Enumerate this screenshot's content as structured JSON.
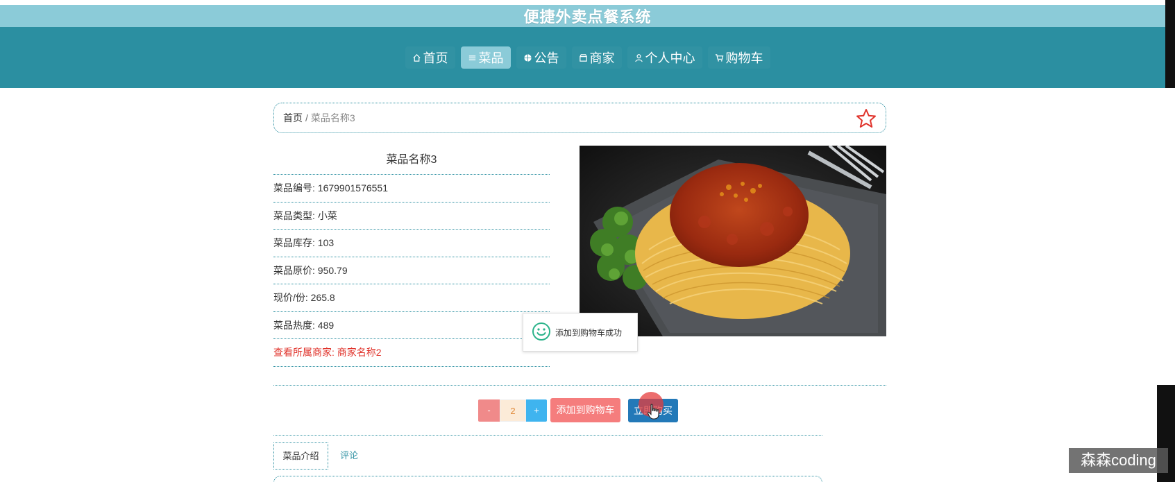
{
  "header": {
    "site_title": "便捷外卖点餐系统",
    "nav": [
      {
        "label": "首页",
        "icon": "home-icon"
      },
      {
        "label": "菜品",
        "icon": "list-icon",
        "active": true
      },
      {
        "label": "公告",
        "icon": "globe-icon"
      },
      {
        "label": "商家",
        "icon": "shop-icon"
      },
      {
        "label": "个人中心",
        "icon": "user-icon"
      },
      {
        "label": "购物车",
        "icon": "cart-icon"
      }
    ]
  },
  "breadcrumb": {
    "home": "首页",
    "separator": "/",
    "current": "菜品名称3",
    "favorite_icon": "star-icon"
  },
  "dish": {
    "title": "菜品名称3",
    "rows": [
      {
        "label": "菜品编号: ",
        "value": "1679901576551"
      },
      {
        "label": "菜品类型: ",
        "value": "小菜"
      },
      {
        "label": "菜品库存: ",
        "value": "103"
      },
      {
        "label": "菜品原价: ",
        "value": "950.79"
      },
      {
        "label": "现价/份: ",
        "value": "265.8"
      },
      {
        "label": "菜品热度: ",
        "value": "489"
      }
    ],
    "merchant_link": "查看所属商家: 商家名称2",
    "image_icon": "spaghetti-photo"
  },
  "toast": {
    "message": "添加到购物车成功",
    "icon": "smile-icon"
  },
  "actions": {
    "minus": "-",
    "quantity": "2",
    "plus": "+",
    "add_to_cart": "添加到购物车",
    "buy_now": "立即购买"
  },
  "tabs": {
    "intro": "菜品介绍",
    "comment": "评论"
  },
  "watermark": "森森coding",
  "colors": {
    "title_band": "#8bcbd8",
    "nav_band": "#2b8fa1",
    "accent_red": "#e0332b",
    "add_cart": "#f57d7d",
    "buy": "#2379b8"
  }
}
